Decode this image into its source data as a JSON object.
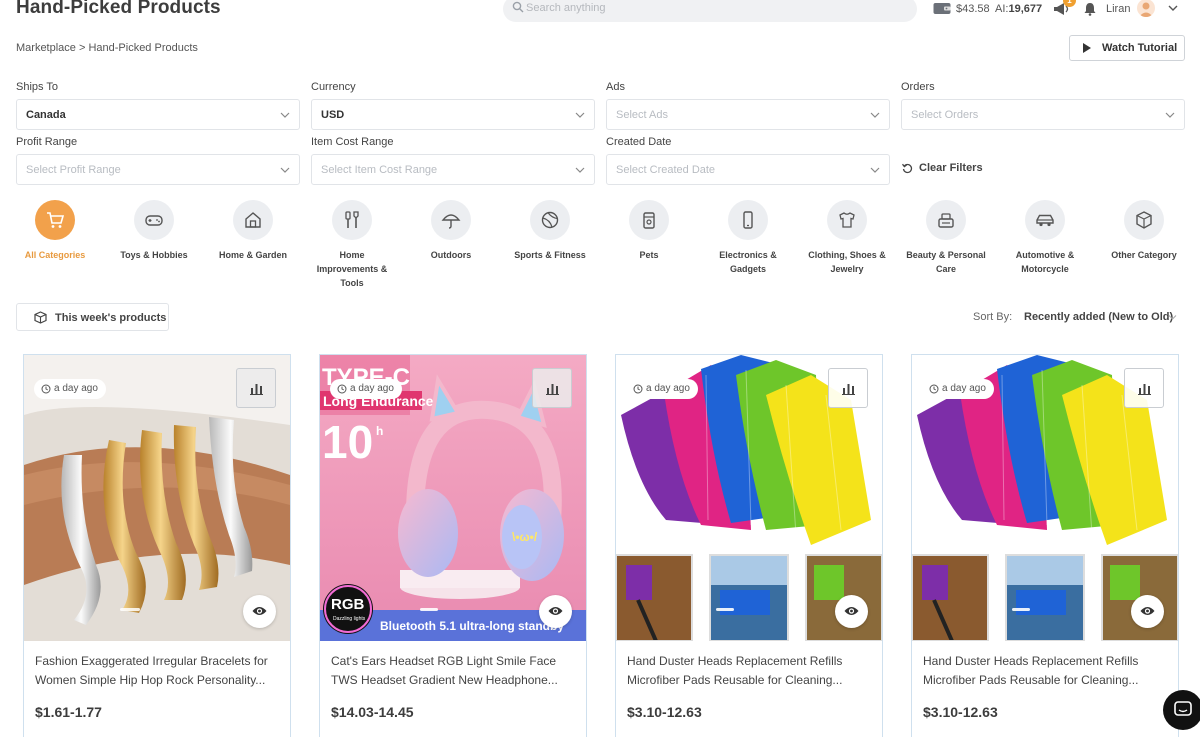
{
  "header": {
    "title": "Hand-Picked Products",
    "search_placeholder": "Search anything",
    "balance": "$43.58",
    "ai_label": "AI:",
    "ai_credits": "19,677",
    "notification_count": "1",
    "username": "Liran"
  },
  "breadcrumb": "Marketplace > Hand-Picked Products",
  "watch_tutorial_label": "Watch Tutorial",
  "filters": {
    "ships_to": {
      "label": "Ships To",
      "value": "Canada"
    },
    "currency": {
      "label": "Currency",
      "value": "USD"
    },
    "ads": {
      "label": "Ads",
      "placeholder": "Select Ads"
    },
    "orders": {
      "label": "Orders",
      "placeholder": "Select Orders"
    },
    "profit_range": {
      "label": "Profit Range",
      "placeholder": "Select Profit Range"
    },
    "item_cost_range": {
      "label": "Item Cost Range",
      "placeholder": "Select Item Cost Range"
    },
    "created_date": {
      "label": "Created Date",
      "placeholder": "Select Created Date"
    },
    "clear_label": "Clear Filters"
  },
  "categories": [
    {
      "label": "All Categories",
      "icon": "cart-icon",
      "active": true
    },
    {
      "label": "Toys & Hobbies",
      "icon": "gamepad-icon"
    },
    {
      "label": "Home & Garden",
      "icon": "home-icon"
    },
    {
      "label": "Home Improvements & Tools",
      "icon": "tools-icon"
    },
    {
      "label": "Outdoors",
      "icon": "umbrella-icon"
    },
    {
      "label": "Sports & Fitness",
      "icon": "ball-icon"
    },
    {
      "label": "Pets",
      "icon": "pet-food-icon"
    },
    {
      "label": "Electronics & Gadgets",
      "icon": "phone-icon"
    },
    {
      "label": "Clothing, Shoes & Jewelry",
      "icon": "shirt-icon"
    },
    {
      "label": "Beauty & Personal Care",
      "icon": "cosmetics-icon"
    },
    {
      "label": "Automotive & Motorcycle",
      "icon": "car-icon"
    },
    {
      "label": "Other Category",
      "icon": "box-icon"
    }
  ],
  "week_products_label": "This week's products",
  "sort": {
    "label": "Sort By:",
    "value": "Recently added (New to Old)"
  },
  "products": [
    {
      "time": "a day ago",
      "title": "Fashion Exaggerated Irregular Bracelets for Women Simple Hip Hop Rock Personality...",
      "price": "$1.61-1.77"
    },
    {
      "time": "a day ago",
      "title": "Cat's Ears Headset RGB Light Smile Face TWS Headset Gradient New Headphone...",
      "price": "$14.03-14.45",
      "image_text": {
        "line1": "TYPE-C",
        "line2": "Long Endurance",
        "line3": "10",
        "line3_unit": "h",
        "badge1": "RGB",
        "badge2": "Dazzling lights",
        "banner": "Bluetooth 5.1 ultra-long standby"
      }
    },
    {
      "time": "a day ago",
      "title": "Hand Duster Heads Replacement Refills Microfiber Pads Reusable for Cleaning...",
      "price": "$3.10-12.63"
    },
    {
      "time": "a day ago",
      "title": "Hand Duster Heads Replacement Refills Microfiber Pads Reusable for Cleaning...",
      "price": "$3.10-12.63"
    }
  ],
  "colors": {
    "accent": "#f2a14b",
    "card_border": "#cfe0ee",
    "text_dark": "#3d3d3d"
  }
}
